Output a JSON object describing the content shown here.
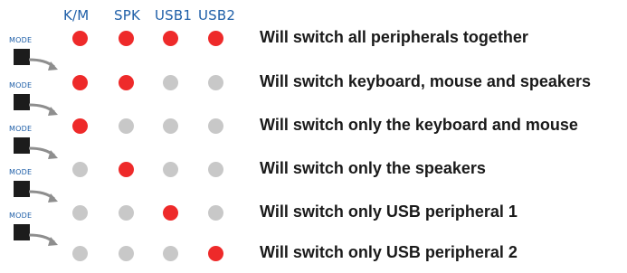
{
  "colors": {
    "on": "#ee2a2a",
    "off": "#c8c8c8",
    "header": "#1f5fa8",
    "text": "#1a1a1a"
  },
  "columns": [
    "K/M",
    "SPK",
    "USB1",
    "USB2"
  ],
  "mode_label": "MODE",
  "rows": [
    {
      "leds": [
        true,
        true,
        true,
        true
      ],
      "text": "Will switch all peripherals together"
    },
    {
      "leds": [
        true,
        true,
        false,
        false
      ],
      "text": "Will switch keyboard, mouse and speakers"
    },
    {
      "leds": [
        true,
        false,
        false,
        false
      ],
      "text": "Will switch only the keyboard and mouse"
    },
    {
      "leds": [
        false,
        true,
        false,
        false
      ],
      "text": "Will switch only the speakers"
    },
    {
      "leds": [
        false,
        false,
        true,
        false
      ],
      "text": "Will switch only USB peripheral 1"
    },
    {
      "leds": [
        false,
        false,
        false,
        true
      ],
      "text": "Will switch only USB peripheral 2"
    }
  ]
}
